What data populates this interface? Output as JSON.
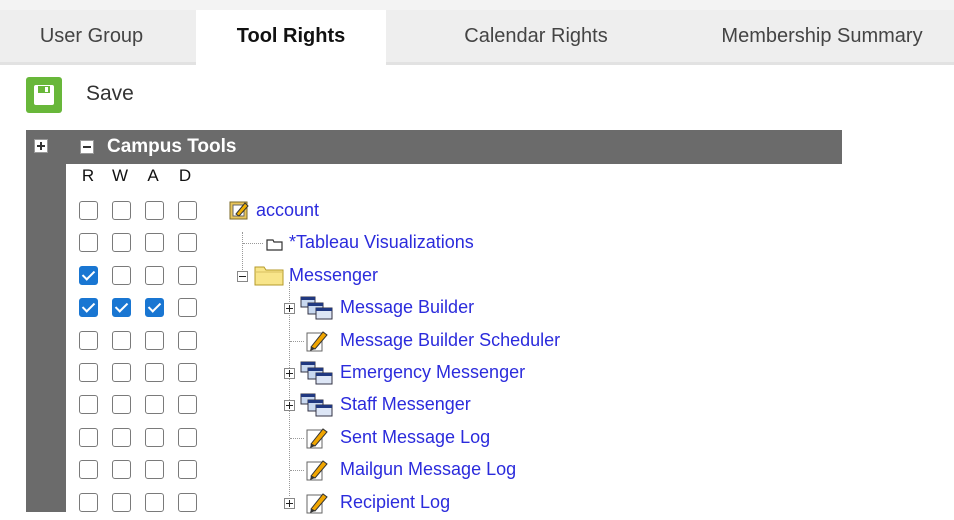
{
  "tabs": {
    "user_group": "User Group",
    "tool_rights": "Tool Rights",
    "calendar_rights": "Calendar Rights",
    "membership_summary": "Membership Summary"
  },
  "toolbar": {
    "save_label": "Save"
  },
  "tree": {
    "title": "Campus Tools",
    "columns": [
      "R",
      "W",
      "A",
      "D"
    ],
    "rows": [
      {
        "label": "account",
        "icon": "account-edit-icon",
        "checks": [
          false,
          false,
          false,
          false
        ]
      },
      {
        "label": "*Tableau Visualizations",
        "icon": "folder-outline-icon",
        "checks": [
          false,
          false,
          false,
          false
        ]
      },
      {
        "label": "Messenger",
        "icon": "folder-icon",
        "checks": [
          true,
          false,
          false,
          false
        ]
      },
      {
        "label": "Message Builder",
        "icon": "windows-icon",
        "checks": [
          true,
          true,
          true,
          false
        ]
      },
      {
        "label": "Message Builder Scheduler",
        "icon": "edit-doc-icon",
        "checks": [
          false,
          false,
          false,
          false
        ]
      },
      {
        "label": "Emergency Messenger",
        "icon": "windows-icon",
        "checks": [
          false,
          false,
          false,
          false
        ]
      },
      {
        "label": "Staff Messenger",
        "icon": "windows-icon",
        "checks": [
          false,
          false,
          false,
          false
        ]
      },
      {
        "label": "Sent Message Log",
        "icon": "edit-doc-icon",
        "checks": [
          false,
          false,
          false,
          false
        ]
      },
      {
        "label": "Mailgun Message Log",
        "icon": "edit-doc-icon",
        "checks": [
          false,
          false,
          false,
          false
        ]
      },
      {
        "label": "Recipient Log",
        "icon": "edit-doc-icon",
        "checks": [
          false,
          false,
          false,
          false
        ]
      }
    ]
  },
  "colors": {
    "accent": "#68b73a",
    "header": "#6b6b6b",
    "link": "#2b2bdc",
    "check": "#1976d2"
  }
}
